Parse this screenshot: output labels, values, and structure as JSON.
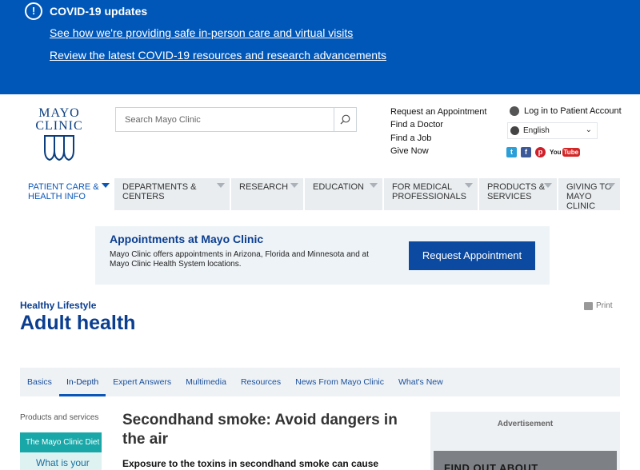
{
  "covid": {
    "icon": "exclamation-icon",
    "title": "COVID-19 updates",
    "links": [
      "See how we're providing safe in-person care and virtual visits",
      "Review the latest COVID-19 resources and research advancements"
    ]
  },
  "logo": {
    "line1": "MAYO",
    "line2": "CLINIC"
  },
  "search": {
    "placeholder": "Search Mayo Clinic"
  },
  "quick_links": [
    "Request an Appointment",
    "Find a Doctor",
    "Find a Job",
    "Give Now"
  ],
  "login": "Log in to Patient Account",
  "language": "English",
  "social": [
    "twitter-icon",
    "facebook-icon",
    "pinterest-icon",
    "youtube-icon"
  ],
  "youtube_text": {
    "you": "You",
    "tube": "Tube"
  },
  "nav": [
    {
      "label1": "PATIENT CARE &",
      "label2": "HEALTH INFO"
    },
    {
      "label1": "DEPARTMENTS &",
      "label2": "CENTERS"
    },
    {
      "label1": "RESEARCH",
      "label2": ""
    },
    {
      "label1": "EDUCATION",
      "label2": ""
    },
    {
      "label1": "FOR MEDICAL",
      "label2": "PROFESSIONALS"
    },
    {
      "label1": "PRODUCTS &",
      "label2": "SERVICES"
    },
    {
      "label1": "GIVING TO",
      "label2": "MAYO CLINIC"
    }
  ],
  "appointments": {
    "title": "Appointments at Mayo Clinic",
    "text": "Mayo Clinic offers appointments in Arizona, Florida and Minnesota and at Mayo Clinic Health System locations.",
    "button": "Request Appointment"
  },
  "page": {
    "kicker": "Healthy Lifestyle",
    "title": "Adult health",
    "print": "Print"
  },
  "tabs": [
    "Basics",
    "In-Depth",
    "Expert Answers",
    "Multimedia",
    "Resources",
    "News From Mayo Clinic",
    "What's New"
  ],
  "sidebar": {
    "label": "Products and services",
    "green": "The Mayo Clinic Diet",
    "box": "What is your"
  },
  "article": {
    "title": "Secondhand smoke: Avoid dangers in the air",
    "lead": "Exposure to the toxins in secondhand smoke can cause"
  },
  "ad": {
    "label": "Advertisement",
    "text": "FIND OUT ABOUT"
  },
  "colors": {
    "brand_blue": "#0057b8",
    "navy": "#0b3e8f",
    "teal": "#1aa7a8"
  }
}
